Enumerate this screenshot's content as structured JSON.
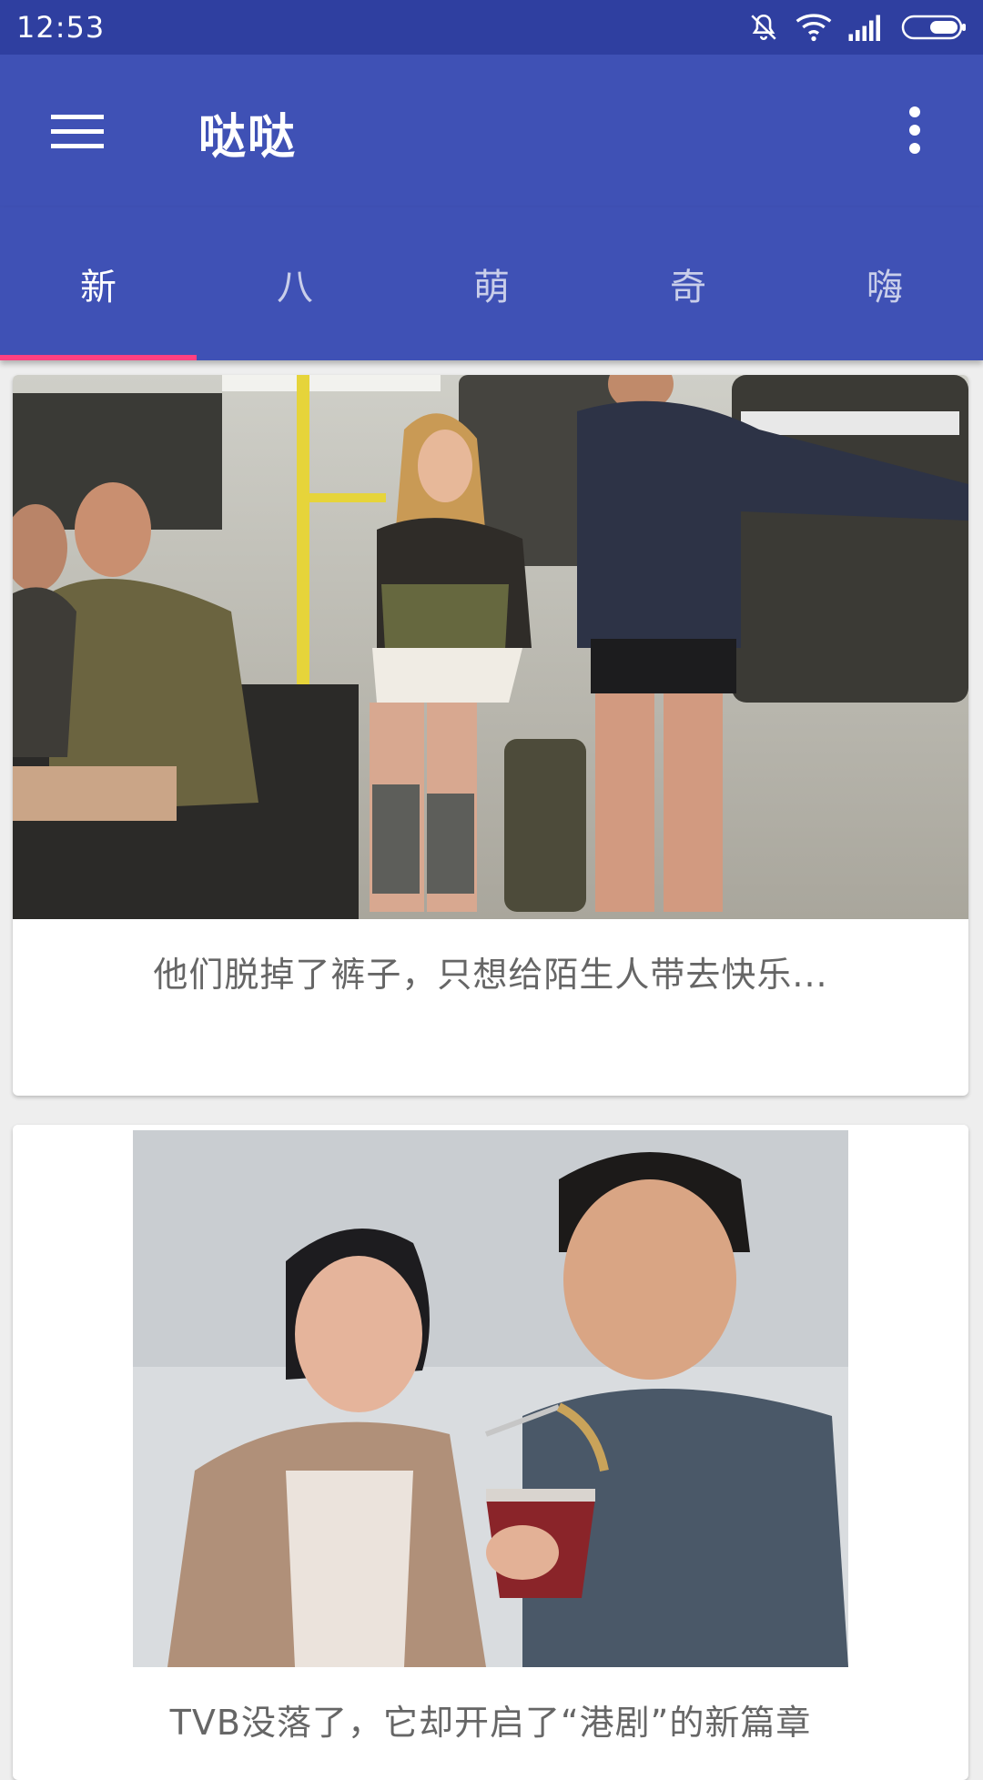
{
  "status_bar": {
    "time": "12:53",
    "icons": [
      "mute-bell-icon",
      "wifi-icon",
      "signal-icon",
      "battery-icon"
    ]
  },
  "app_bar": {
    "title": "哒哒",
    "menu_icon": "hamburger-menu-icon",
    "more_icon": "more-vertical-icon"
  },
  "tabs": [
    {
      "label": "新",
      "active": true
    },
    {
      "label": "八",
      "active": false
    },
    {
      "label": "萌",
      "active": false
    },
    {
      "label": "奇",
      "active": false
    },
    {
      "label": "嗨",
      "active": false
    }
  ],
  "feed": [
    {
      "caption": "他们脱掉了裤子，只想给陌生人带去快乐..."
    },
    {
      "caption": "TVB没落了，它却开启了“港剧”的新篇章"
    }
  ],
  "colors": {
    "status_bar": "#2f3fa0",
    "primary": "#3f51b5",
    "accent": "#ff4081",
    "background": "#eeeeee"
  }
}
